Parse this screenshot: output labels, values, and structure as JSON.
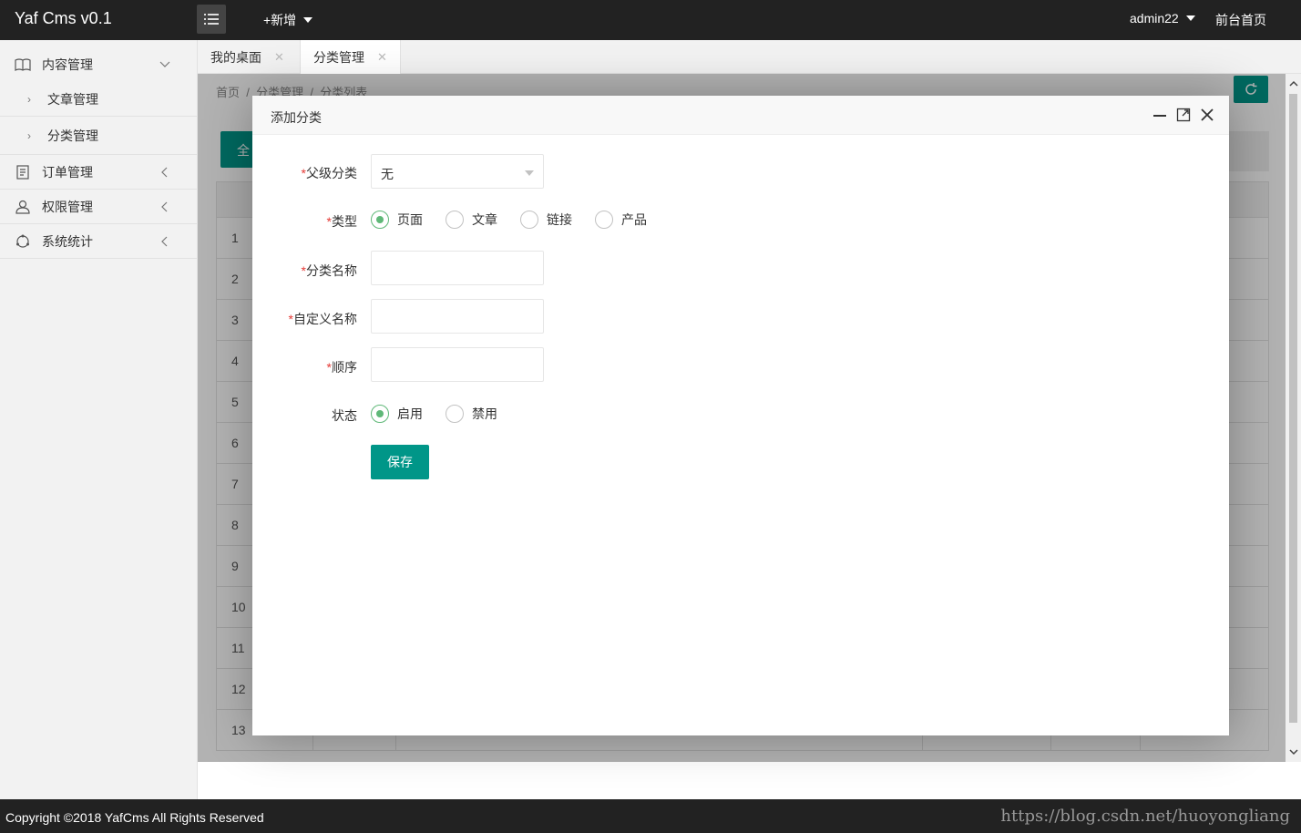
{
  "header": {
    "brand": "Yaf Cms v0.1",
    "add_new": "+新增",
    "user": "admin22",
    "front_link": "前台首页"
  },
  "sidebar": {
    "items": [
      {
        "label": "内容管理",
        "icon": "book-icon",
        "expanded": true,
        "children": [
          {
            "label": "文章管理"
          },
          {
            "label": "分类管理"
          }
        ]
      },
      {
        "label": "订单管理",
        "icon": "order-icon"
      },
      {
        "label": "权限管理",
        "icon": "user-icon"
      },
      {
        "label": "系统统计",
        "icon": "stats-icon"
      }
    ]
  },
  "tabs": [
    {
      "label": "我的桌面",
      "active": false
    },
    {
      "label": "分类管理",
      "active": true
    }
  ],
  "content": {
    "breadcrumb": [
      "首页",
      "分类管理",
      "分类列表"
    ],
    "breadcrumb_sep": "/",
    "partial_button": "全",
    "row_numbers": [
      "1",
      "2",
      "3",
      "4",
      "5",
      "6",
      "7",
      "8",
      "9",
      "10",
      "11",
      "12",
      "13"
    ]
  },
  "modal": {
    "title": "添加分类",
    "fields": {
      "parent": {
        "label": "父级分类",
        "value": "无",
        "required": true
      },
      "type": {
        "label": "类型",
        "required": true,
        "options": [
          "页面",
          "文章",
          "链接",
          "产品"
        ],
        "selected": "页面"
      },
      "name": {
        "label": "分类名称",
        "required": true,
        "value": ""
      },
      "custom_name": {
        "label": "自定义名称",
        "required": true,
        "value": ""
      },
      "order": {
        "label": "顺序",
        "required": true,
        "value": ""
      },
      "status": {
        "label": "状态",
        "required": false,
        "options": [
          "启用",
          "禁用"
        ],
        "selected": "启用"
      }
    },
    "required_mark": "*",
    "save_label": "保存"
  },
  "footer": {
    "copyright": "Copyright ©2018 YafCms All Rights Reserved",
    "watermark": "https://blog.csdn.net/huoyongliang"
  },
  "colors": {
    "primary": "#009688",
    "radio_checked": "#5FB878",
    "header_bg": "#222222"
  }
}
